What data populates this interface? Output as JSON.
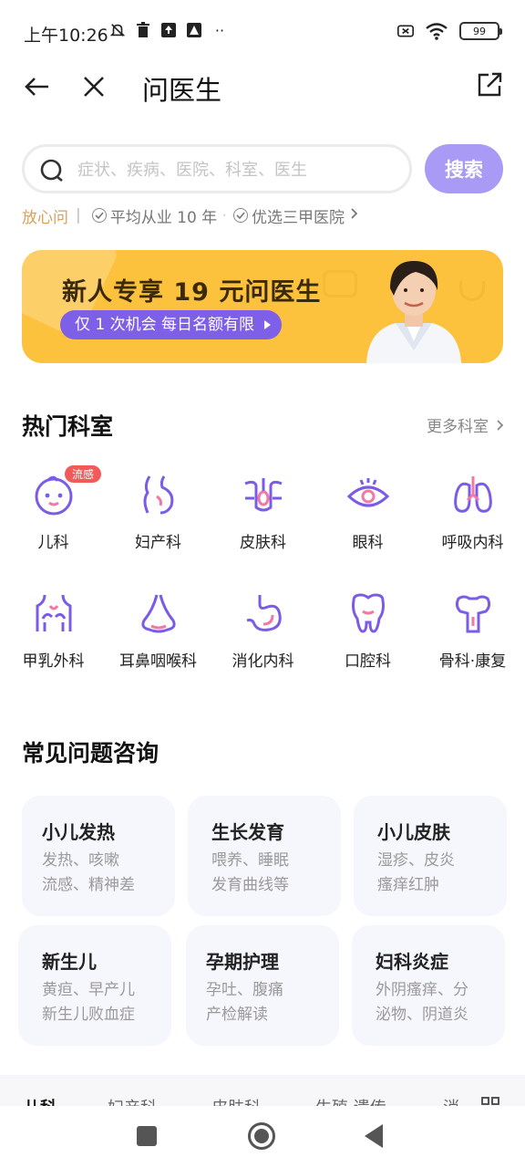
{
  "status_bar": {
    "time": "上午10:26",
    "battery": "99"
  },
  "header": {
    "title": "问医生"
  },
  "search": {
    "placeholder": "症状、疾病、医院、科室、医生",
    "button": "搜索"
  },
  "assurance": {
    "brand": "放心问",
    "item1": "平均从业 10 年",
    "item2": "优选三甲医院"
  },
  "banner": {
    "title": "新人专享 19 元问医生",
    "pill": "仅 1 次机会  每日名额有限"
  },
  "departments": {
    "title": "热门科室",
    "more": "更多科室",
    "badge": "流感",
    "items": [
      {
        "label": "儿科",
        "icon": "baby-face-icon"
      },
      {
        "label": "妇产科",
        "icon": "pregnancy-icon"
      },
      {
        "label": "皮肤科",
        "icon": "skin-icon"
      },
      {
        "label": "眼科",
        "icon": "eye-icon"
      },
      {
        "label": "呼吸内科",
        "icon": "lungs-icon"
      },
      {
        "label": "甲乳外科",
        "icon": "chest-icon"
      },
      {
        "label": "耳鼻咽喉科",
        "icon": "nose-icon"
      },
      {
        "label": "消化内科",
        "icon": "stomach-icon"
      },
      {
        "label": "口腔科",
        "icon": "tooth-icon"
      },
      {
        "label": "骨科·康复",
        "icon": "bone-icon"
      }
    ]
  },
  "faq": {
    "title": "常见问题咨询",
    "cards": [
      {
        "title": "小儿发热",
        "desc": "发热、咳嗽\n流感、精神差"
      },
      {
        "title": "生长发育",
        "desc": "喂养、睡眠\n发育曲线等"
      },
      {
        "title": "小儿皮肤",
        "desc": "湿疹、皮炎\n瘙痒红肿"
      },
      {
        "title": "新生儿",
        "desc": "黄疸、早产儿\n新生儿败血症"
      },
      {
        "title": "孕期护理",
        "desc": "孕吐、腹痛\n产检解读"
      },
      {
        "title": "妇科炎症",
        "desc": "外阴瘙痒、分\n泌物、阴道炎"
      }
    ]
  },
  "tabs": [
    "儿科",
    "妇产科",
    "皮肤科",
    "生殖·遗传",
    "消"
  ],
  "colors": {
    "accent": "#8e6ff0",
    "search_button": "#a99af5",
    "banner": "#fcc13d",
    "brand_gold": "#d9a05b"
  }
}
